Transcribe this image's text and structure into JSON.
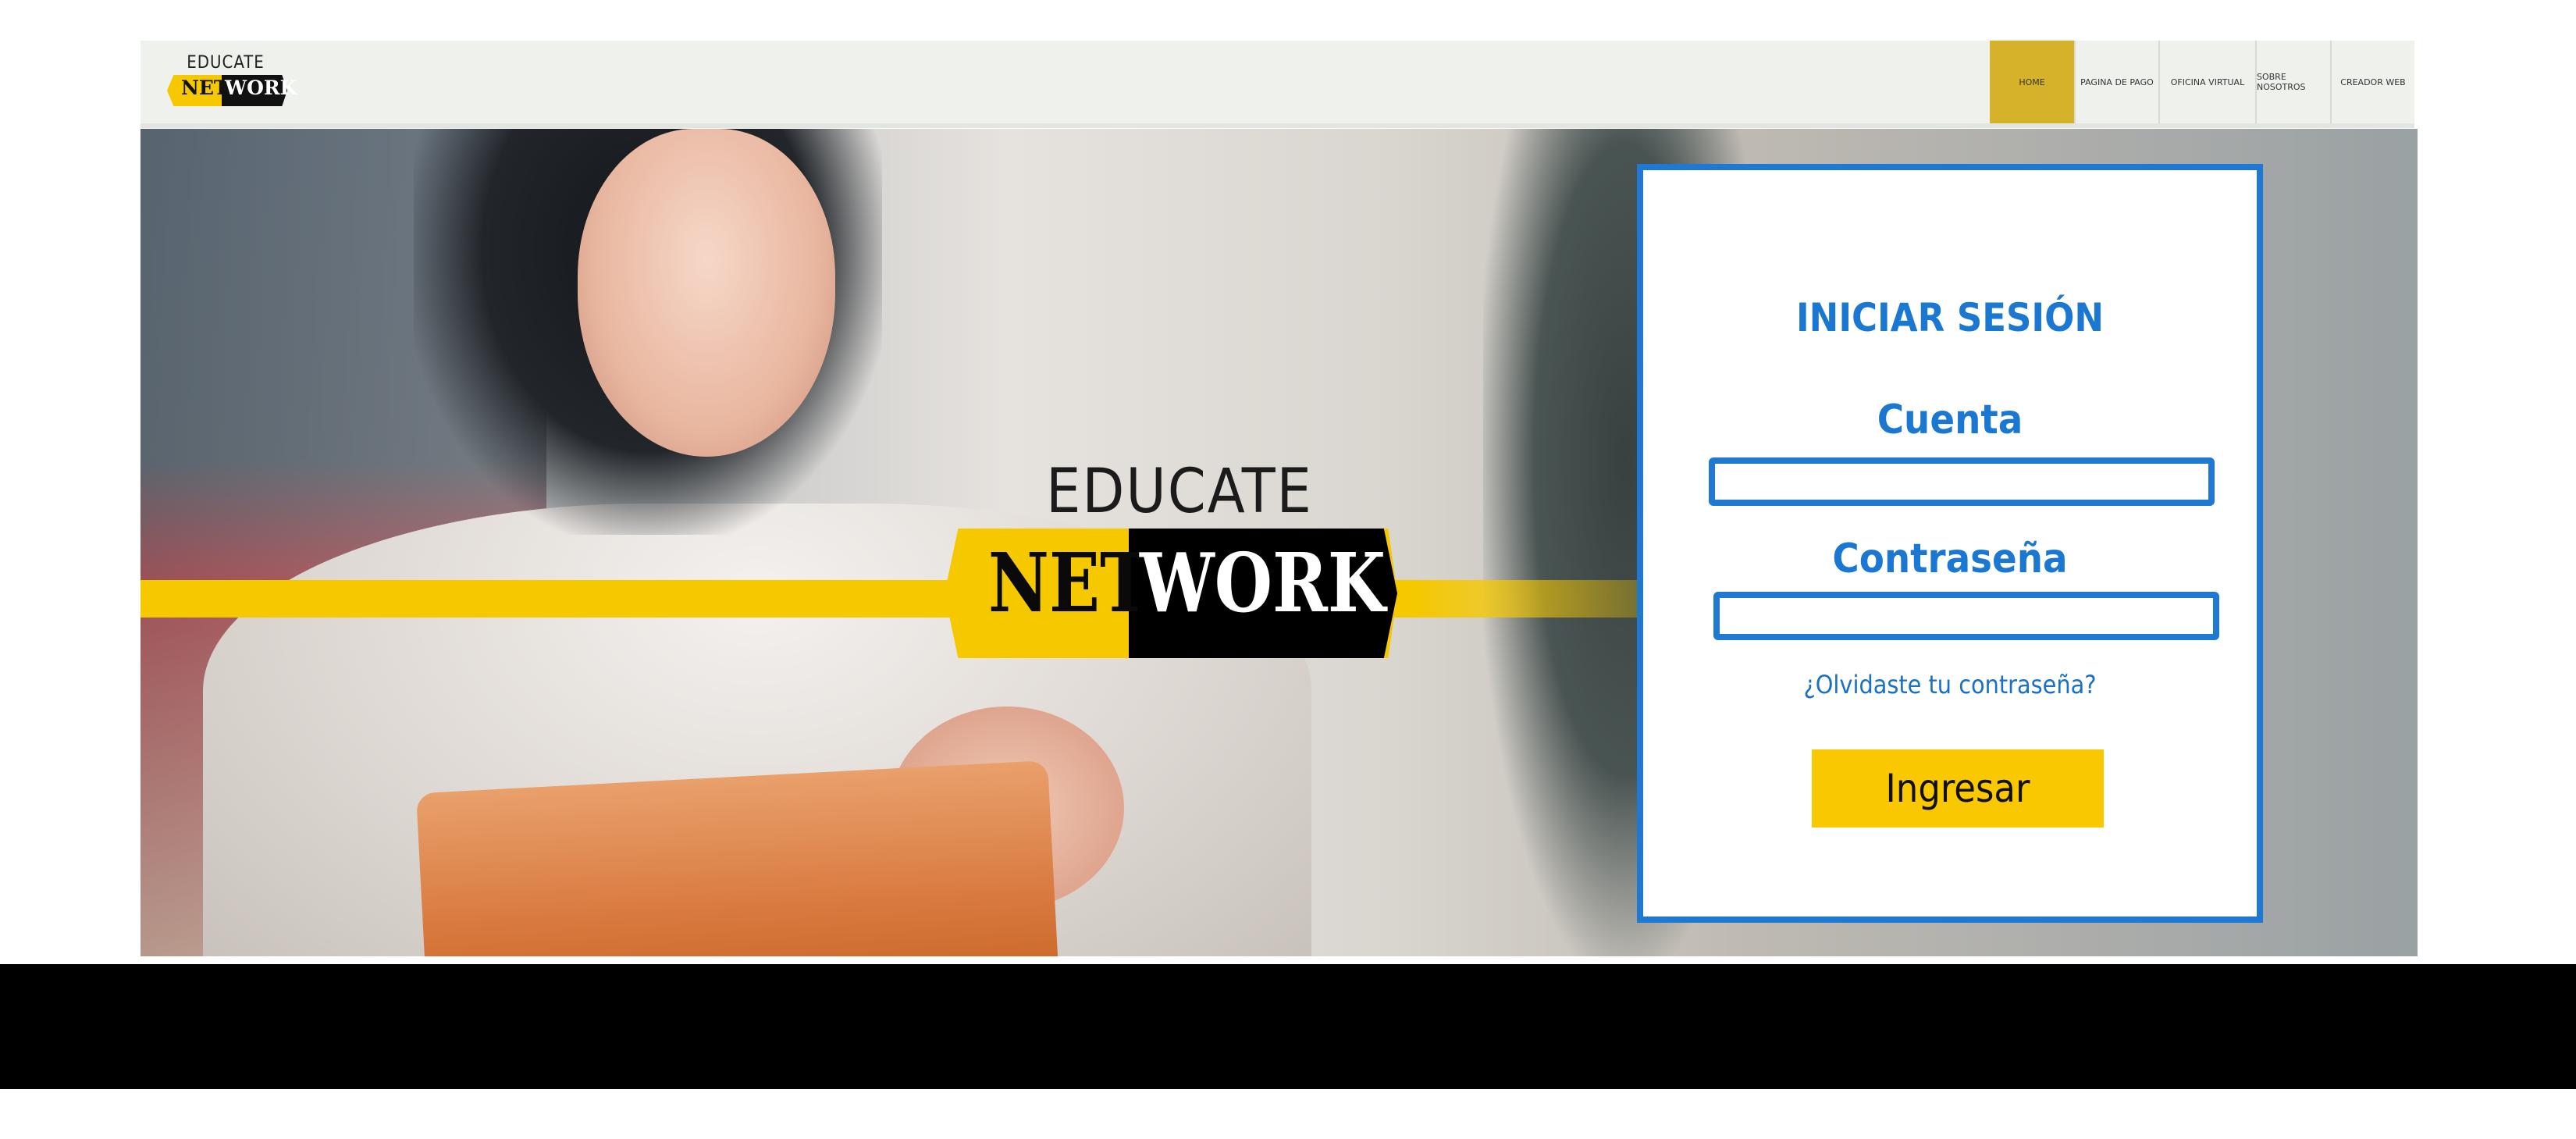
{
  "header": {
    "logo": {
      "top": "EDUCATE",
      "left": "NET",
      "right": "WORK"
    },
    "nav": [
      {
        "label": "HOME",
        "active": true,
        "width": 108
      },
      {
        "label": "PAGINA DE PAGO",
        "active": false,
        "width": 108
      },
      {
        "label": "OFICINA VIRTUAL",
        "active": false,
        "width": 124
      },
      {
        "label": "SOBRE NOSOTROS",
        "active": false,
        "width": 96
      },
      {
        "label": "CREADOR WEB",
        "active": false,
        "width": 108
      }
    ]
  },
  "hero": {
    "logo": {
      "top": "EDUCATE",
      "left": "NET",
      "right": "WORK"
    }
  },
  "login": {
    "title": "INICIAR SESIÓN",
    "account_label": "Cuenta",
    "account_value": "",
    "password_label": "Contraseña",
    "password_value": "",
    "forgot_link": "¿Olvidaste tu contraseña?",
    "submit_label": "Ingresar"
  },
  "colors": {
    "accent_blue": "#1f79d2",
    "accent_yellow": "#f9c800",
    "nav_active": "#d6b22a"
  }
}
